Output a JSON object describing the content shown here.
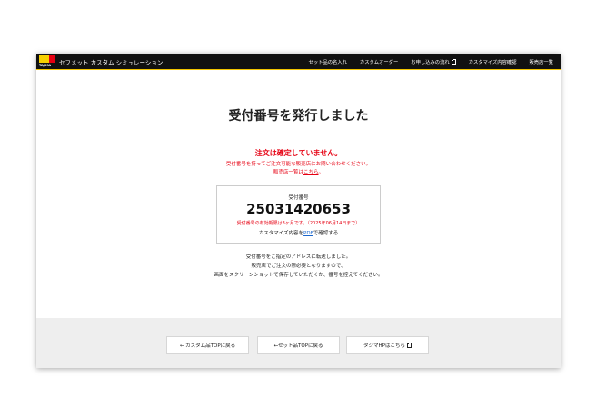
{
  "header": {
    "logo_text": "TAJIMA",
    "app_title": "セフメット カスタム シミュレーション",
    "nav": [
      {
        "label": "セット品の名入れ",
        "external": false
      },
      {
        "label": "カスタムオーダー",
        "external": false
      },
      {
        "label": "お申し込みの流れ",
        "external": true
      },
      {
        "label": "カスタマイズ内容確認",
        "external": false
      },
      {
        "label": "販売店一覧",
        "external": false
      }
    ]
  },
  "main": {
    "title": "受付番号を発行しました",
    "warning_title": "注文は確定していません。",
    "warning_line1": "受付番号を持ってご注文可能な販売店にお問い合わせください。",
    "warning_line2_prefix": "販売店一覧は",
    "warning_line2_link": "こちら",
    "warning_line2_suffix": "。"
  },
  "receipt": {
    "label": "受付番号",
    "number": "25031420653",
    "expiry": "受付番号の有効期限は3ヶ月です。（2025年06月14日まで）",
    "pdf_prefix": "カスタマイズ内容を",
    "pdf_link": "PDF",
    "pdf_suffix": "で確認する"
  },
  "info": {
    "line1": "受付番号をご指定のアドレスに転送しました。",
    "line2": "販売店でご注文の際必要となりますので、",
    "line3": "画面をスクリーンショットで保存していただくか、番号を控えてください。"
  },
  "footer": {
    "btn_custom_top": "← カスタム品TOPに戻る",
    "btn_set_top": "←セット品TOPに戻る",
    "btn_tajima_hp": "タジマHPはこちら"
  },
  "colors": {
    "accent_red": "#e60012",
    "brand_yellow": "#f6d000",
    "topbar_bg": "#111111",
    "link_blue": "#1a66cc"
  },
  "icons": {
    "external_link": "external-link-icon"
  }
}
